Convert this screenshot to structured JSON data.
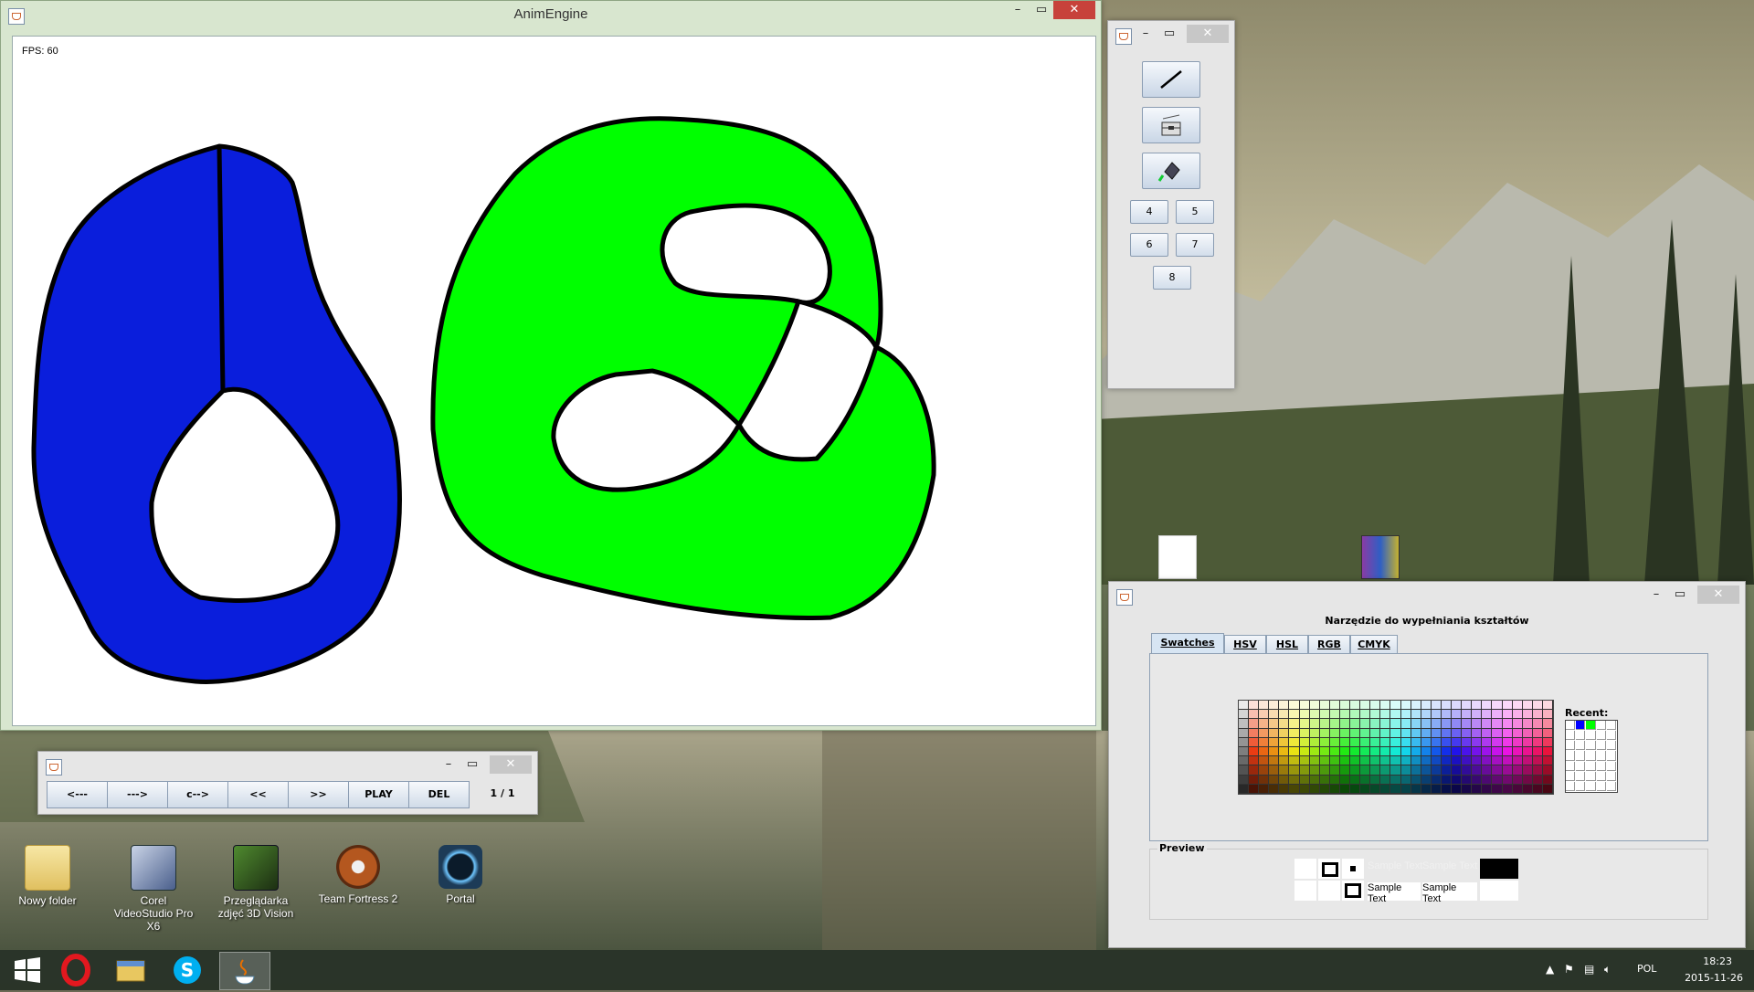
{
  "app_window": {
    "title": "AnimEngine",
    "fps_label": "FPS: 60",
    "shapes": [
      {
        "name": "blue-shape",
        "fill": "#0a1edc",
        "stroke": "#000000"
      },
      {
        "name": "green-shape",
        "fill": "#00ff00",
        "stroke": "#000000"
      }
    ]
  },
  "tool_palette": {
    "tools": [
      {
        "name": "line-tool",
        "icon": "line-icon"
      },
      {
        "name": "brush-tool",
        "icon": "toolbox-icon"
      },
      {
        "name": "fill-tool",
        "icon": "paint-bucket-icon"
      }
    ],
    "number_buttons": [
      "4",
      "5",
      "6",
      "7",
      "8"
    ]
  },
  "player": {
    "buttons": [
      "<---",
      "--->",
      "c-->",
      "<<",
      ">>",
      "PLAY",
      "DEL"
    ],
    "frame_count": "1 / 1"
  },
  "color_chooser": {
    "title": "Narzędzie do wypełniania kształtów",
    "tabs": [
      "Swatches",
      "HSV",
      "HSL",
      "RGB",
      "CMYK"
    ],
    "active_tab": "Swatches",
    "recent_label": "Recent:",
    "recent_colors": [
      "#0000ff",
      "#00ff00"
    ],
    "preview_label": "Preview",
    "sample_text": "Sample Text"
  },
  "desktop_icons": [
    {
      "label": "Nowy folder",
      "icon": "folder-icon"
    },
    {
      "label": "Corel VideoStudio Pro X6",
      "icon": "corel-videostudio-icon"
    },
    {
      "label": "Przeglądarka zdjęć 3D Vision",
      "icon": "3d-vision-viewer-icon"
    },
    {
      "label": "Team Fortress 2",
      "icon": "team-fortress-2-icon"
    },
    {
      "label": "Portal",
      "icon": "portal-icon"
    }
  ],
  "taskbar": {
    "items": [
      "start-icon",
      "opera-icon",
      "file-explorer-icon",
      "skype-icon",
      "java-icon"
    ],
    "language": "POL",
    "time": "18:23",
    "date": "2015-11-26"
  }
}
